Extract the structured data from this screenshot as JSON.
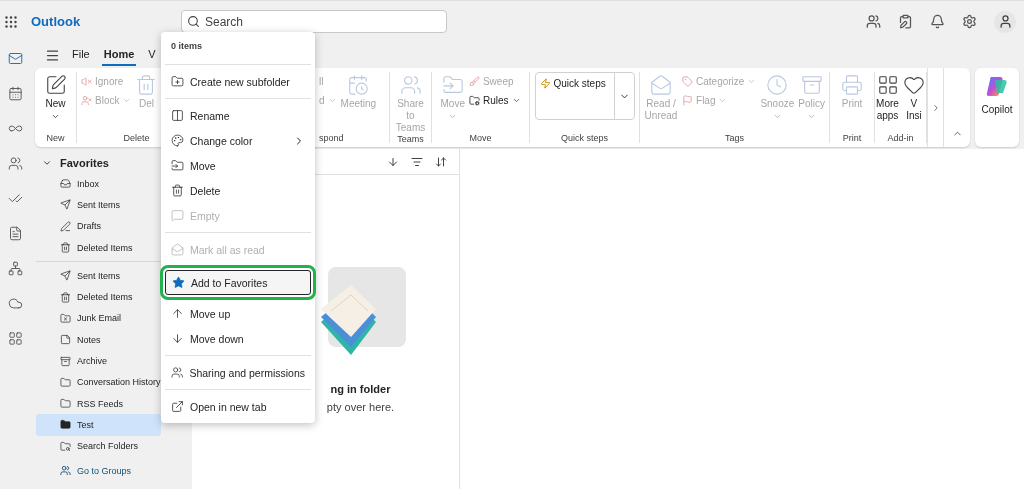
{
  "app": {
    "name": "Outlook"
  },
  "search": {
    "placeholder": "Search"
  },
  "nav_rail": [
    {
      "selected": true
    },
    {
      "selected": false
    },
    {
      "selected": false
    },
    {
      "selected": false
    },
    {
      "selected": false
    },
    {
      "selected": false
    },
    {
      "selected": false
    },
    {
      "selected": false
    },
    {
      "selected": false
    }
  ],
  "ribbon_tabs": [
    {
      "label": "File",
      "selected": false
    },
    {
      "label": "Home",
      "selected": true
    },
    {
      "label": "V",
      "selected": false
    }
  ],
  "ribbon": {
    "groups": [
      {
        "label": "New",
        "buttons": [
          {
            "kind": "large",
            "label": "New",
            "disabled": false,
            "dropdown": true
          }
        ]
      },
      {
        "label": "Delete",
        "buttons": [
          {
            "kind": "small",
            "label": "Ignore",
            "disabled": true,
            "dropdown": false
          },
          {
            "kind": "small",
            "label": "Block",
            "disabled": true,
            "dropdown": true
          },
          {
            "kind": "large",
            "label": "Del",
            "disabled": true,
            "dropdown": false
          }
        ]
      },
      {
        "label": "spond",
        "buttons": [
          {
            "kind": "small",
            "label": "ll",
            "disabled": true,
            "dropdown": false
          },
          {
            "kind": "small",
            "label": "d",
            "disabled": true,
            "dropdown": true
          },
          {
            "kind": "large",
            "label": "Meeting",
            "disabled": true,
            "dropdown": false
          }
        ]
      },
      {
        "label": "Teams",
        "buttons": [
          {
            "kind": "large",
            "label": "Share to Teams",
            "disabled": true,
            "dropdown": false
          }
        ]
      },
      {
        "label": "Move",
        "buttons": [
          {
            "kind": "large",
            "label": "Move",
            "disabled": true,
            "dropdown": true
          },
          {
            "kind": "small",
            "label": "Sweep",
            "disabled": true,
            "dropdown": false
          },
          {
            "kind": "small",
            "label": "Rules",
            "disabled": false,
            "dropdown": true
          }
        ]
      },
      {
        "label": "Quick steps",
        "buttons": [
          {
            "kind": "split",
            "label": "Quick steps",
            "disabled": false,
            "dropdown": true
          }
        ]
      },
      {
        "label": "Tags",
        "buttons": [
          {
            "kind": "large",
            "label": "Read / Unread",
            "disabled": true,
            "dropdown": false
          },
          {
            "kind": "small",
            "label": "Categorize",
            "disabled": true,
            "dropdown": true
          },
          {
            "kind": "small",
            "label": "Flag",
            "disabled": true,
            "dropdown": true
          },
          {
            "kind": "large",
            "label": "Snooze",
            "disabled": true,
            "dropdown": true
          },
          {
            "kind": "large",
            "label": "Policy",
            "disabled": true,
            "dropdown": true
          }
        ]
      },
      {
        "label": "Print",
        "buttons": [
          {
            "kind": "large",
            "label": "Print",
            "disabled": true,
            "dropdown": false
          }
        ]
      },
      {
        "label": "Add-in",
        "buttons": [
          {
            "kind": "large",
            "label": "More apps",
            "disabled": false,
            "dropdown": false
          },
          {
            "kind": "large",
            "label": "V Insi",
            "disabled": false,
            "dropdown": false
          }
        ]
      }
    ]
  },
  "copilot": {
    "label": "Copilot"
  },
  "folders": {
    "favorites": {
      "label": "Favorites",
      "expanded": true,
      "items": [
        {
          "label": "Inbox",
          "selected": false
        },
        {
          "label": "Sent Items",
          "selected": false
        },
        {
          "label": "Drafts",
          "selected": false
        },
        {
          "label": "Deleted Items",
          "selected": false
        }
      ]
    },
    "items": [
      {
        "label": "Sent Items",
        "selected": false
      },
      {
        "label": "Deleted Items",
        "selected": false
      },
      {
        "label": "Junk Email",
        "selected": false
      },
      {
        "label": "Notes",
        "selected": false
      },
      {
        "label": "Archive",
        "selected": false
      },
      {
        "label": "Conversation History",
        "selected": false
      },
      {
        "label": "RSS Feeds",
        "selected": false
      },
      {
        "label": "Test",
        "selected": true
      },
      {
        "label": "Search Folders",
        "selected": false
      }
    ],
    "go_to_groups": "Go to Groups"
  },
  "message_list": {
    "empty_title": "ng in folder",
    "empty_text": "pty over here."
  },
  "context_menu": {
    "header": "0 items",
    "sections": [
      [
        {
          "label": "Create new subfolder",
          "disabled": false,
          "highlighted": false,
          "submenu": false
        }
      ],
      [
        {
          "label": "Rename",
          "disabled": false,
          "highlighted": false,
          "submenu": false
        },
        {
          "label": "Change color",
          "disabled": false,
          "highlighted": false,
          "submenu": true
        },
        {
          "label": "Move",
          "disabled": false,
          "highlighted": false,
          "submenu": false
        },
        {
          "label": "Delete",
          "disabled": false,
          "highlighted": false,
          "submenu": false
        },
        {
          "label": "Empty",
          "disabled": true,
          "highlighted": false,
          "submenu": false
        }
      ],
      [
        {
          "label": "Mark all as read",
          "disabled": true,
          "highlighted": false,
          "submenu": false
        },
        {
          "label": "Add to Favorites",
          "disabled": false,
          "highlighted": true,
          "submenu": false
        },
        {
          "label": "Move up",
          "disabled": false,
          "highlighted": false,
          "submenu": false
        },
        {
          "label": "Move down",
          "disabled": false,
          "highlighted": false,
          "submenu": false
        }
      ],
      [
        {
          "label": "Sharing and permissions",
          "disabled": false,
          "highlighted": false,
          "submenu": false
        }
      ],
      [
        {
          "label": "Open in new tab",
          "disabled": false,
          "highlighted": false,
          "submenu": false
        }
      ]
    ]
  }
}
